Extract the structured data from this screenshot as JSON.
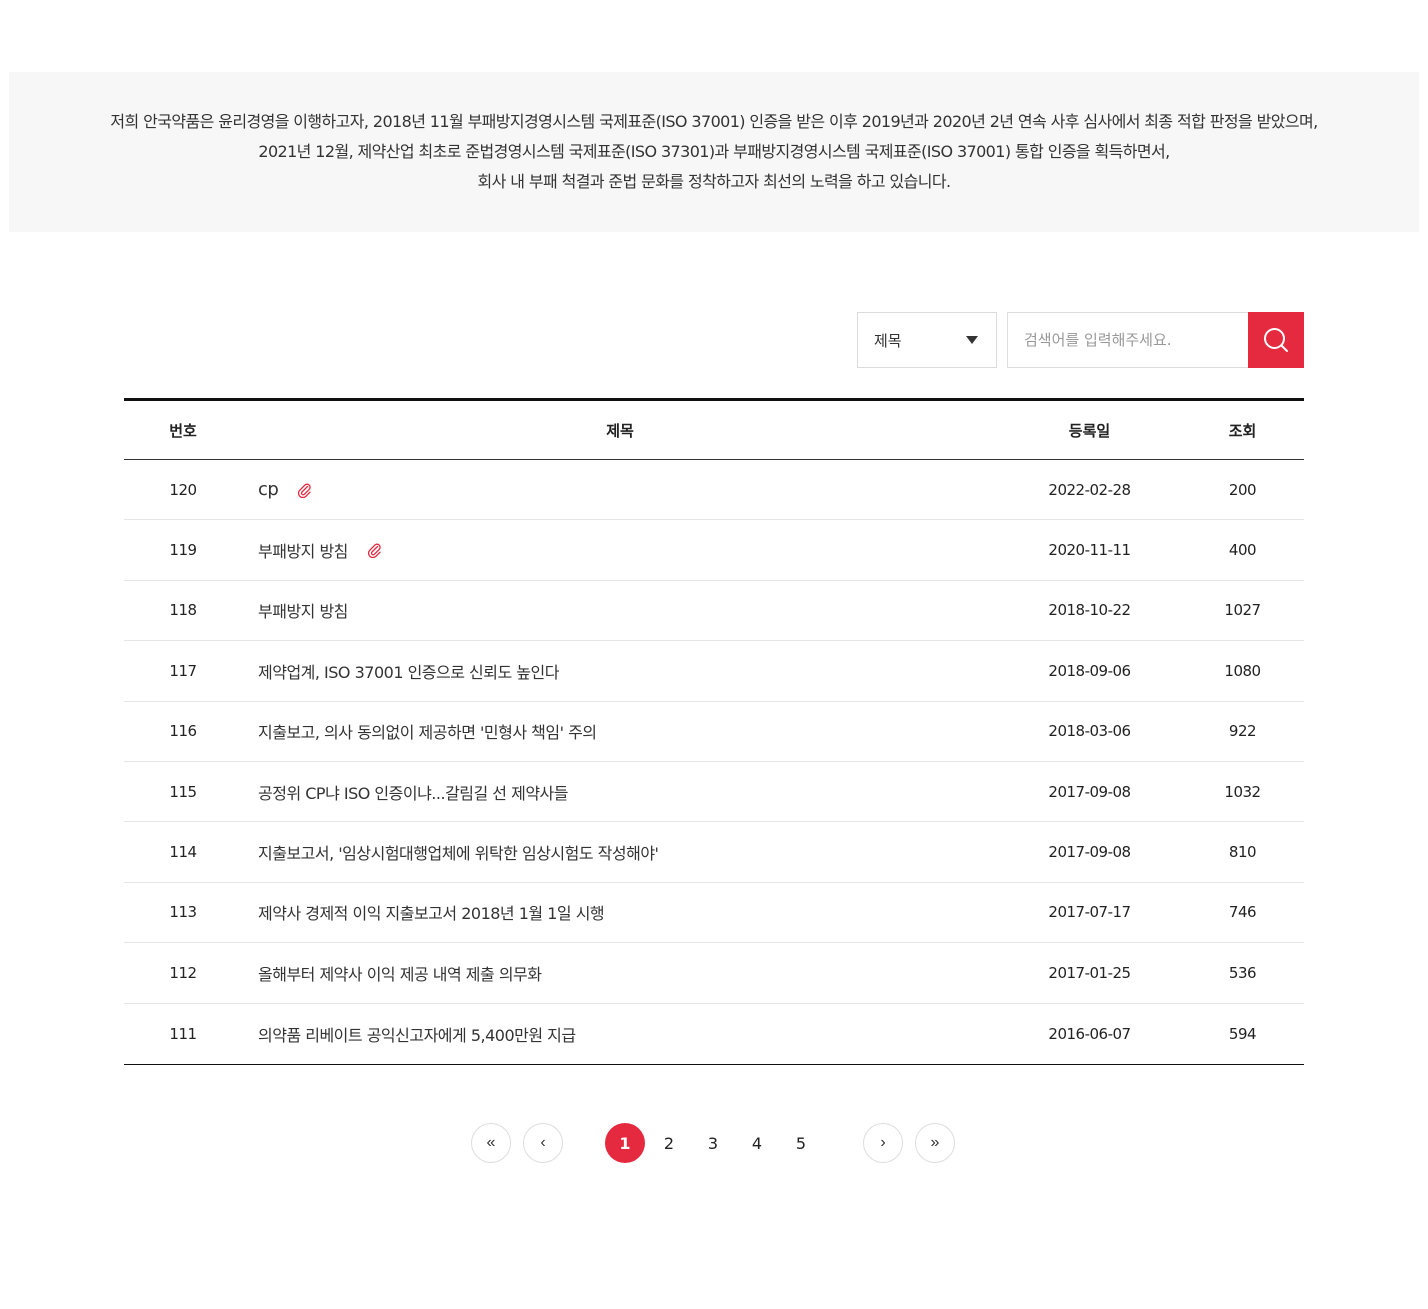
{
  "intro": {
    "lines": [
      "저희 안국약품은 윤리경영을 이행하고자, 2018년 11월 부패방지경영시스템 국제표준(ISO 37001) 인증을 받은 이후 2019년과 2020년 2년 연속 사후 심사에서 최종 적합 판정을 받았으며,",
      "2021년 12월, 제약산업 최초로 준법경영시스템 국제표준(ISO 37301)과 부패방지경영시스템 국제표준(ISO 37001) 통합 인증을 획득하면서,",
      "회사 내 부패 척결과 준법 문화를 정착하고자 최선의 노력을 하고 있습니다."
    ]
  },
  "search": {
    "select_value": "제목",
    "placeholder": "검색어를 입력해주세요.",
    "button_icon": "search-icon",
    "accent_color": "#e5293f"
  },
  "board": {
    "headers": {
      "no": "번호",
      "title": "제목",
      "date": "등록일",
      "views": "조회"
    },
    "rows": [
      {
        "no": "120",
        "title": "cp",
        "date": "2022-02-28",
        "views": "200",
        "attachment": true
      },
      {
        "no": "119",
        "title": "부패방지 방침",
        "date": "2020-11-11",
        "views": "400",
        "attachment": true
      },
      {
        "no": "118",
        "title": "부패방지 방침",
        "date": "2018-10-22",
        "views": "1027",
        "attachment": false
      },
      {
        "no": "117",
        "title": "제약업계, ISO 37001 인증으로 신뢰도 높인다",
        "date": "2018-09-06",
        "views": "1080",
        "attachment": false
      },
      {
        "no": "116",
        "title": "지출보고, 의사 동의없이 제공하면 '민형사 책임' 주의",
        "date": "2018-03-06",
        "views": "922",
        "attachment": false
      },
      {
        "no": "115",
        "title": "공정위 CP냐 ISO 인증이냐...갈림길 선 제약사들",
        "date": "2017-09-08",
        "views": "1032",
        "attachment": false
      },
      {
        "no": "114",
        "title": "지출보고서, '임상시험대행업체에 위탁한 임상시험도 작성해야'",
        "date": "2017-09-08",
        "views": "810",
        "attachment": false
      },
      {
        "no": "113",
        "title": "제약사 경제적 이익 지출보고서 2018년 1월 1일 시행",
        "date": "2017-07-17",
        "views": "746",
        "attachment": false
      },
      {
        "no": "112",
        "title": "올해부터 제약사 이익 제공 내역 제출 의무화",
        "date": "2017-01-25",
        "views": "536",
        "attachment": false
      },
      {
        "no": "111",
        "title": "의약품 리베이트 공익신고자에게 5,400만원 지급",
        "date": "2016-06-07",
        "views": "594",
        "attachment": false
      }
    ]
  },
  "pagination": {
    "first": "«",
    "prev": "‹",
    "pages": [
      "1",
      "2",
      "3",
      "4",
      "5"
    ],
    "current": "1",
    "next": "›",
    "last": "»"
  }
}
